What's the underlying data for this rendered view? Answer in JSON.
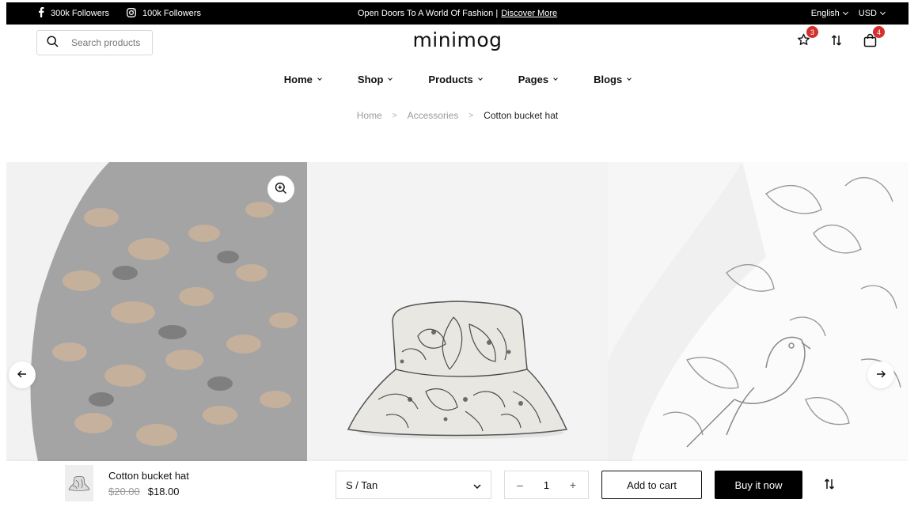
{
  "topbar": {
    "facebook_followers": "300k Followers",
    "instagram_followers": "100k Followers",
    "promo_text": "Open Doors To A World Of Fashion |",
    "promo_link": "Discover More",
    "language": "English",
    "currency": "USD"
  },
  "header": {
    "logo": "minimog",
    "search_placeholder": "Search products",
    "wishlist_count": "3",
    "cart_count": "4"
  },
  "nav": {
    "items": [
      {
        "label": "Home"
      },
      {
        "label": "Shop"
      },
      {
        "label": "Products"
      },
      {
        "label": "Pages"
      },
      {
        "label": "Blogs"
      }
    ]
  },
  "breadcrumb": {
    "items": [
      "Home",
      "Accessories"
    ],
    "current": "Cotton bucket hat"
  },
  "sticky_bar": {
    "product_name": "Cotton bucket hat",
    "old_price": "$20.00",
    "price": "$18.00",
    "variant": "S / Tan",
    "quantity": "1",
    "add_to_cart": "Add to cart",
    "buy_now": "Buy it now"
  },
  "colors": {
    "topbar_bg": "#000000",
    "badge": "#d3302f",
    "buy_button": "#000000"
  }
}
